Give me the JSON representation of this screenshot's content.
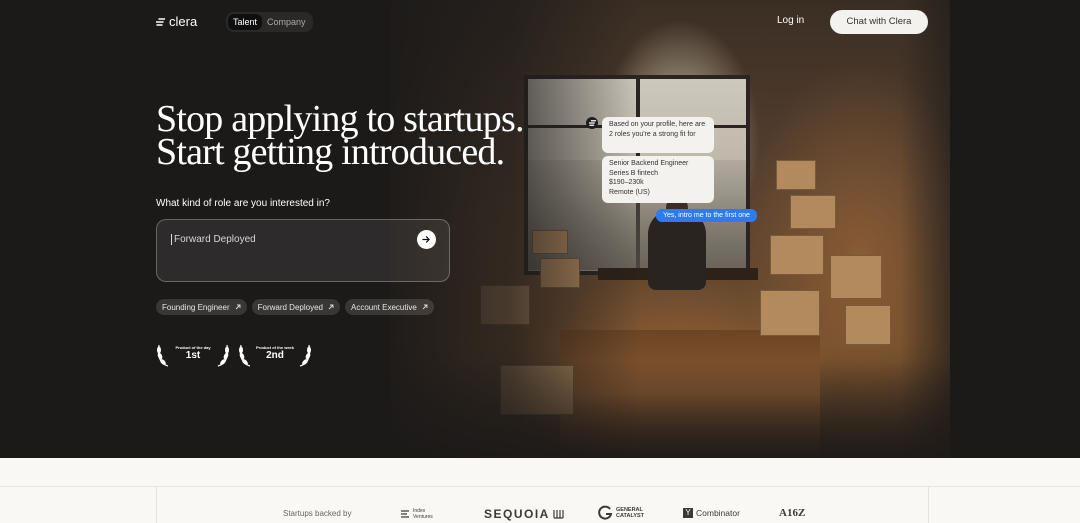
{
  "nav": {
    "brand": "clera",
    "toggle": [
      "Talent",
      "Company"
    ],
    "login": "Log in",
    "cta": "Chat with Clera"
  },
  "hero": {
    "headline_line1": "Stop applying to startups.",
    "headline_line2": "Start getting introduced.",
    "question": "What kind of role are you interested in?",
    "input_value": "Forward Deployed",
    "chips": [
      "Founding Engineer",
      "Forward Deployed",
      "Account Executive"
    ],
    "awards": [
      {
        "label": "Product of the day",
        "rank": "1st"
      },
      {
        "label": "Product of the week",
        "rank": "2nd"
      }
    ]
  },
  "chat": {
    "message1": "Based on your profile, here are 2 roles you're a strong fit for",
    "role_title": "Senior Backend Engineer",
    "role_company": "Series B fintech",
    "role_salary": "$190–230k",
    "role_location": "Remote (US)",
    "reply": "Yes, intro me to the first one"
  },
  "backers": {
    "label": "Startups backed by",
    "logos": [
      "Index Ventures",
      "SEQUOIA",
      "GENERAL CATALYST",
      "Combinator",
      "A16Z"
    ]
  },
  "colors": {
    "hero_bg": "#1c1a19",
    "cta_bg": "#f4f2ee",
    "reply_blue": "#2d7bf0",
    "lower_bg": "#faf8f4"
  }
}
